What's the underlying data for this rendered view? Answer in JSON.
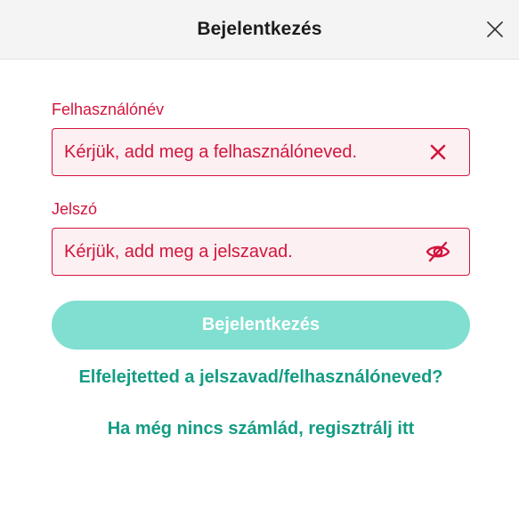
{
  "dialog": {
    "title": "Bejelentkezés",
    "close_icon": "close-icon"
  },
  "form": {
    "username": {
      "label": "Felhasználónév",
      "value": "",
      "placeholder": "Kérjük, add meg a felhasználóneved.",
      "clear_icon": "clear-x-icon",
      "state": "error"
    },
    "password": {
      "label": "Jelszó",
      "value": "",
      "placeholder": "Kérjük, add meg a jelszavad.",
      "toggle_icon": "eye-slash-icon",
      "state": "error"
    },
    "submit_label": "Bejelentkezés",
    "forgot_link": "Elfelejtetted a jelszavad/felhasználóneved?",
    "register_link": "Ha még nincs számlád, regisztrálj itt"
  },
  "colors": {
    "error": "#d2153d",
    "error_bg": "#fdf0f2",
    "accent": "#149c84",
    "button_disabled": "#80dfd0",
    "header_bg": "#f4f4f4"
  }
}
